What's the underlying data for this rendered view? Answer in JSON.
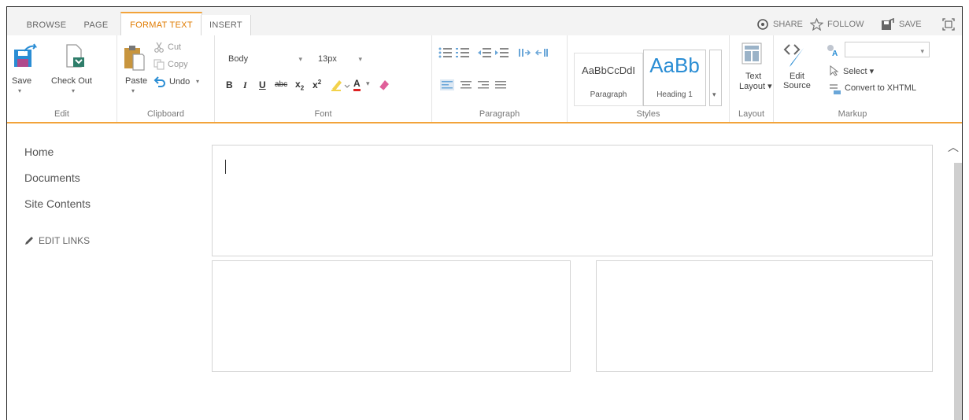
{
  "tabs": {
    "browse": "BROWSE",
    "page": "PAGE",
    "format_text": "FORMAT TEXT",
    "insert": "INSERT"
  },
  "top_actions": {
    "share": "SHARE",
    "follow": "FOLLOW",
    "save": "SAVE"
  },
  "ribbon": {
    "edit": {
      "save": "Save",
      "check_out": "Check Out",
      "group": "Edit"
    },
    "clipboard": {
      "paste": "Paste",
      "cut": "Cut",
      "copy": "Copy",
      "undo": "Undo",
      "group": "Clipboard"
    },
    "font": {
      "family": "Body",
      "size": "13px",
      "bold": "B",
      "italic": "I",
      "underline": "U",
      "strike": "abc",
      "subscript": "x",
      "superscript": "x",
      "font_color": "A",
      "group": "Font"
    },
    "paragraph": {
      "group": "Paragraph"
    },
    "styles": {
      "paragraph_preview": "AaBbCcDdI",
      "paragraph_label": "Paragraph",
      "heading_preview": "AaBb",
      "heading_label": "Heading 1",
      "group": "Styles"
    },
    "layout": {
      "text_layout_line1": "Text",
      "text_layout_line2": "Layout",
      "group": "Layout"
    },
    "markup": {
      "edit_source_line1": "Edit",
      "edit_source_line2": "Source",
      "select": "Select",
      "convert": "Convert to XHTML",
      "group": "Markup"
    }
  },
  "nav": {
    "items": [
      "Home",
      "Documents",
      "Site Contents"
    ],
    "edit_links": "EDIT LINKS"
  },
  "colors": {
    "accent": "#f2a33a",
    "accent_text": "#e07b00",
    "link_blue": "#2a8dd4"
  }
}
